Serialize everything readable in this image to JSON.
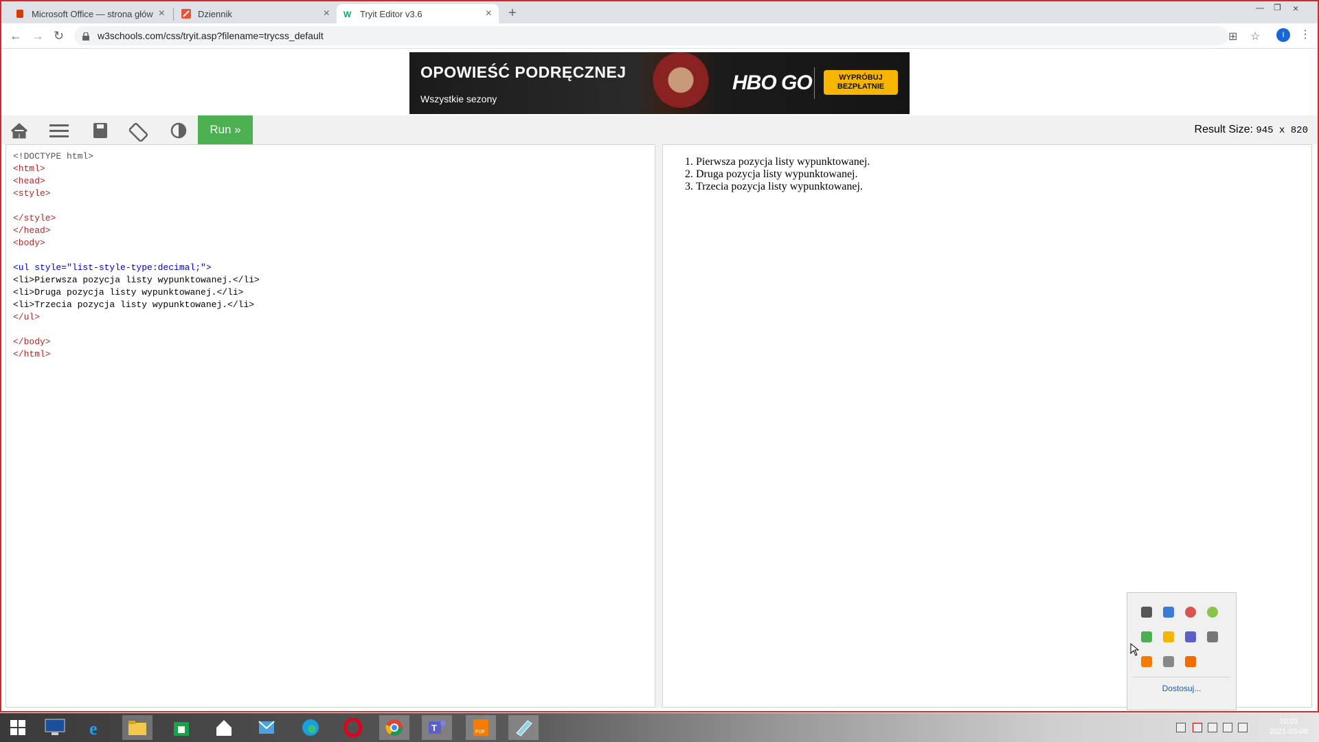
{
  "browser": {
    "tabs": [
      {
        "title": "Microsoft Office — strona główna",
        "active": false
      },
      {
        "title": "Dziennik",
        "active": false
      },
      {
        "title": "Tryit Editor v3.6",
        "active": true
      }
    ],
    "url": "w3schools.com/css/tryit.asp?filename=trycss_default",
    "profile_initial": "I"
  },
  "ad": {
    "headline": "OPOWIEŚĆ PODRĘCZNEJ",
    "subline": "Wszystkie sezony",
    "brand": "HBO GO",
    "cta": "WYPRÓBUJ BEZPŁATNIE"
  },
  "toolbar": {
    "run_label": "Run »",
    "result_size_label": "Result Size:",
    "result_size_value": "945 x 820"
  },
  "editor": {
    "lines": [
      "<!DOCTYPE html>",
      "<html>",
      "<head>",
      "<style>",
      "",
      "</style>",
      "</head>",
      "<body>",
      "",
      "<ul style=\"list-style-type:decimal;\">",
      "<li>Pierwsza pozycja listy wypunktowanej.</li>",
      "<li>Druga pozycja listy wypunktowanej.</li>",
      "<li>Trzecia pozycja listy wypunktowanej.</li>",
      "</ul>",
      "",
      "</body>",
      "</html>"
    ]
  },
  "result": {
    "items": [
      "Pierwsza pozycja listy wypunktowanej.",
      "Druga pozycja listy wypunktowanej.",
      "Trzecia pozycja listy wypunktowanej."
    ]
  },
  "tray_popup": {
    "customize_link": "Dostosuj..."
  },
  "taskbar": {
    "time": "10:01",
    "date": "2021-03-08"
  }
}
